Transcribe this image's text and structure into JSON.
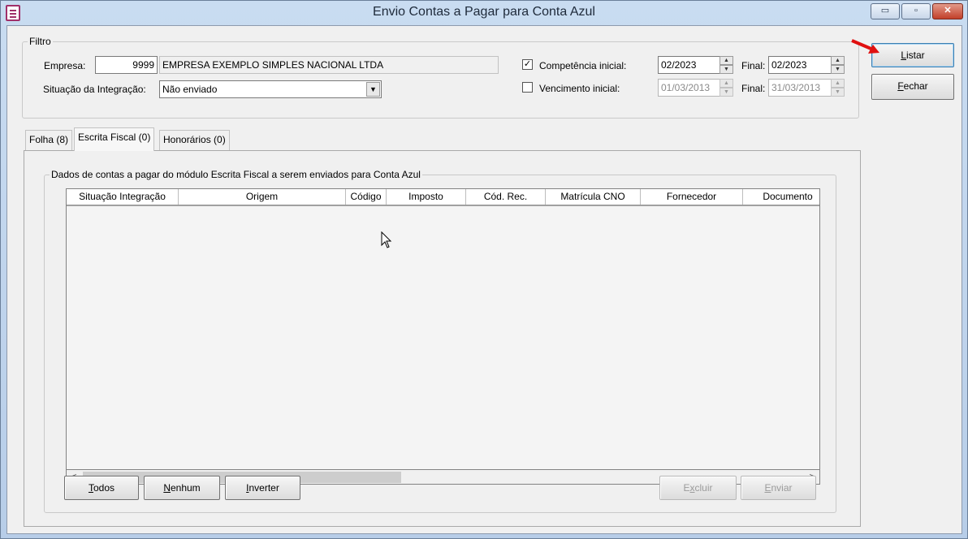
{
  "window": {
    "title": "Envio Contas a Pagar para Conta Azul",
    "icon": "document-icon",
    "min_glyph": "▭",
    "max_glyph": "▫",
    "close_glyph": "✕"
  },
  "filter": {
    "legend": "Filtro",
    "empresa_label": "Empresa:",
    "empresa_code": "9999",
    "empresa_name": "EMPRESA EXEMPLO SIMPLES NACIONAL LTDA",
    "situacao_label": "Situação da Integração:",
    "situacao_value": "Não enviado",
    "competencia": {
      "checked": true,
      "check_glyph": "✓",
      "label": "Competência inicial:",
      "initial": "02/2023",
      "final_label": "Final:",
      "final": "02/2023"
    },
    "vencimento": {
      "checked": false,
      "check_glyph": "",
      "label": "Vencimento inicial:",
      "initial": "01/03/2013",
      "final_label": "Final:",
      "final": "31/03/2013"
    }
  },
  "side_buttons": {
    "listar": {
      "pre": "",
      "accel": "L",
      "post": "istar"
    },
    "fechar": {
      "pre": "",
      "accel": "F",
      "post": "echar"
    }
  },
  "tabs": [
    {
      "label": "Folha (8)",
      "active": false
    },
    {
      "label": "Escrita Fiscal (0)",
      "active": true
    },
    {
      "label": "Honorários (0)",
      "active": false
    }
  ],
  "panel": {
    "legend": "Dados de contas a pagar do módulo Escrita Fiscal a serem enviados para Conta Azul",
    "columns": [
      "Situação Integração",
      "Origem",
      "Código",
      "Imposto",
      "Cód. Rec.",
      "Matrícula CNO",
      "Fornecedor",
      "Documento"
    ],
    "rows": [],
    "scroll_left": "<",
    "scroll_right": ">"
  },
  "bottom_buttons": {
    "todos": {
      "pre": "",
      "accel": "T",
      "post": "odos"
    },
    "nenhum": {
      "pre": "",
      "accel": "N",
      "post": "enhum"
    },
    "inverter": {
      "pre": "",
      "accel": "I",
      "post": "nverter"
    },
    "excluir": {
      "pre": "E",
      "accel": "x",
      "post": "cluir"
    },
    "enviar": {
      "pre": "",
      "accel": "E",
      "post": "nviar"
    }
  },
  "colors": {
    "accent_arrow": "#e01010",
    "titlebar": "#b9d1ea"
  }
}
